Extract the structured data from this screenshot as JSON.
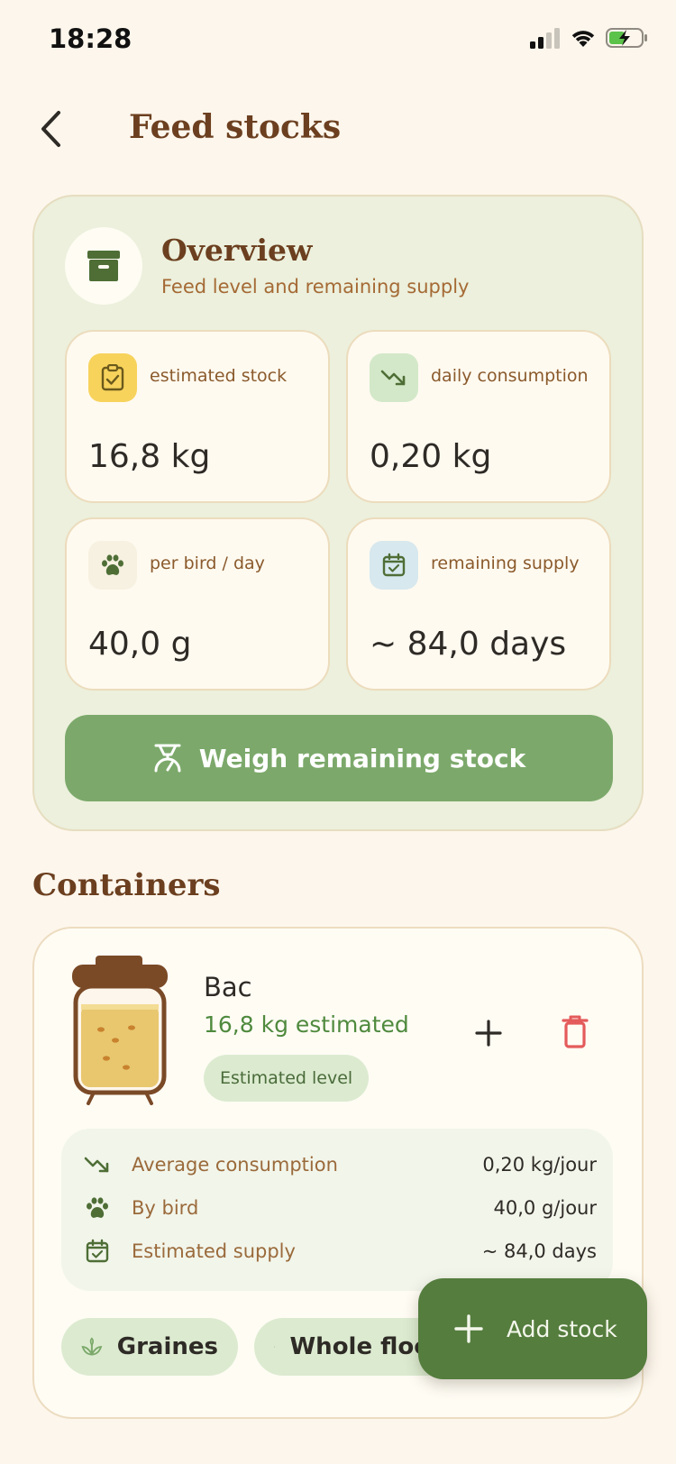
{
  "status": {
    "time": "18:28"
  },
  "header": {
    "title": "Feed stocks"
  },
  "overview": {
    "title": "Overview",
    "subtitle": "Feed level and remaining supply",
    "stats": [
      {
        "label": "estimated stock",
        "value": "16,8 kg",
        "icon": "clipboard-check-icon"
      },
      {
        "label": "daily consumption",
        "value": "0,20 kg",
        "icon": "trending-down-icon"
      },
      {
        "label": "per bird / day",
        "value": "40,0 g",
        "icon": "paw-icon"
      },
      {
        "label": "remaining supply",
        "value": "~ 84,0 days",
        "icon": "calendar-check-icon"
      }
    ],
    "weigh_button": "Weigh remaining stock"
  },
  "containers": {
    "title": "Containers",
    "items": [
      {
        "name": "Bac",
        "amount": "16,8 kg estimated",
        "badge": "Estimated level",
        "fill_level": 0.8,
        "details": [
          {
            "label": "Average consumption",
            "value": "0,20 kg/jour",
            "icon": "trending-down-icon"
          },
          {
            "label": "By bird",
            "value": "40,0 g/jour",
            "icon": "paw-icon"
          },
          {
            "label": "Estimated supply",
            "value": "~ 84,0 days",
            "icon": "calendar-check-icon"
          }
        ],
        "tags": [
          {
            "label": "Graines",
            "icon": "sprout-icon"
          },
          {
            "label": "Whole flock",
            "icon": "paw-icon"
          }
        ]
      }
    ]
  },
  "fab": {
    "label": "Add stock"
  },
  "colors": {
    "background": "#fdf6ec",
    "brown": "#6b3f1f",
    "green_button": "#7ca96b",
    "fab_green": "#557d3e",
    "delete_red": "#e45b5b"
  }
}
